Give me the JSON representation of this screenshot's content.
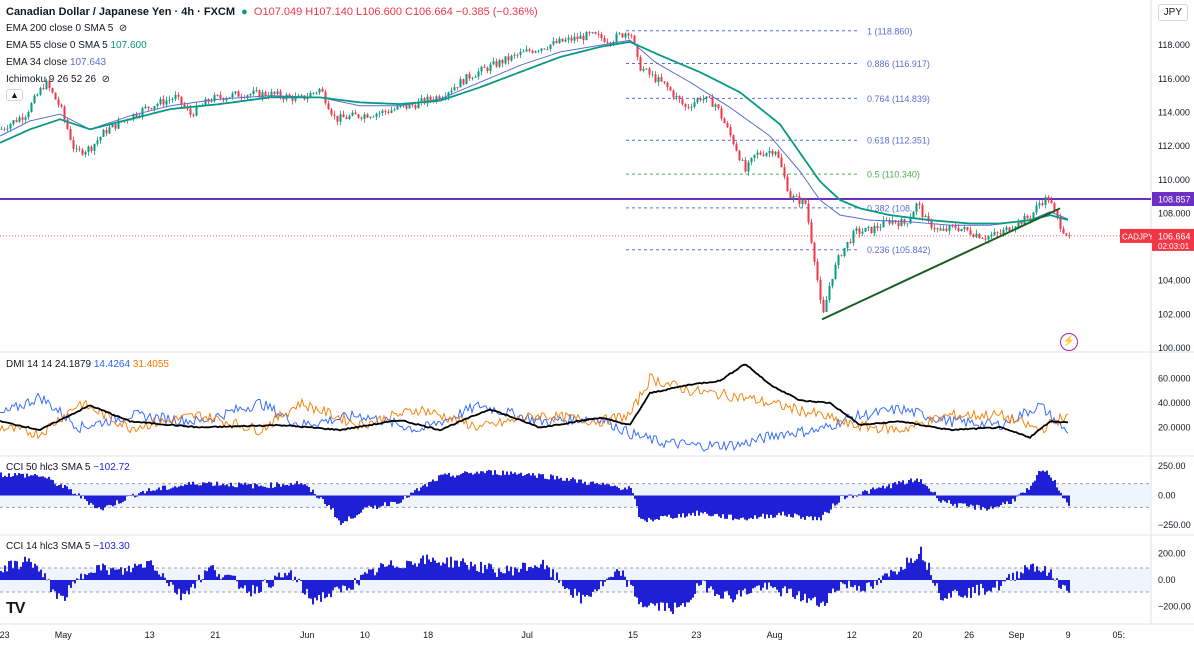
{
  "header": {
    "symbol": "Canadian Dollar / Japanese Yen · 4h · FXCM",
    "ohlc": "O107.049 H107.140 L106.600 C106.664 −0.385 (−0.36%)",
    "currency": "JPY"
  },
  "indicators": {
    "ema200": "EMA 200 close 0 SMA 5",
    "ema55": "EMA 55 close 0 SMA 5",
    "ema55_val": "107.600",
    "ema34": "EMA 34 close",
    "ema34_val": "107.643",
    "ichimoku": "Ichimoku 9 26 52 26",
    "dmi": "DMI 14 14",
    "dmi_adx": "24.1879",
    "dmi_plus": "14.4264",
    "dmi_minus": "31.4055",
    "cci50": "CCI 50 hlc3 SMA 5",
    "cci50_val": "−102.72",
    "cci14": "CCI 14 hlc3 SMA 5",
    "cci14_val": "−103.30"
  },
  "colors": {
    "up": "#089981",
    "down": "#f23645",
    "ema55": "#089981",
    "ema34": "#5b6fd4",
    "resistance": "#6b2fc4",
    "trend": "#1b5e20",
    "fib": "#5b6fd4",
    "fib_mid": "#4caf50",
    "adx": "#000000",
    "plus": "#2962ff",
    "minus": "#f57c00",
    "cci": "#1f1fd6"
  },
  "price_axis": [
    "118.000",
    "116.000",
    "114.000",
    "112.000",
    "110.000",
    "108.000",
    "104.000",
    "102.000",
    "100.000"
  ],
  "price_labels": {
    "resistance": "108.857",
    "current_symbol": "CADJPY",
    "current": "106.664",
    "countdown": "02:03:01"
  },
  "fib_levels": [
    {
      "label": "1 (118.860)",
      "value": 118.86
    },
    {
      "label": "0.886 (116.917)",
      "value": 116.917
    },
    {
      "label": "0.764 (114.839)",
      "value": 114.839
    },
    {
      "label": "0.618 (112.351)",
      "value": 112.351
    },
    {
      "label": "0.5 (110.340)",
      "value": 110.34
    },
    {
      "label": "0.382 (108.",
      "value": 108.33
    },
    {
      "label": "0.236 (105.842)",
      "value": 105.842
    }
  ],
  "dmi_axis": [
    "60.0000",
    "40.0000",
    "20.0000"
  ],
  "cci50_axis": [
    "250.00",
    "0.00",
    "−250.00"
  ],
  "cci14_axis": [
    "200.00",
    "0.00",
    "−200.00"
  ],
  "time_axis": [
    {
      "label": "23",
      "pos": 0.004
    },
    {
      "label": "May",
      "pos": 0.055
    },
    {
      "label": "13",
      "pos": 0.13
    },
    {
      "label": "21",
      "pos": 0.187
    },
    {
      "label": "Jun",
      "pos": 0.267
    },
    {
      "label": "10",
      "pos": 0.317
    },
    {
      "label": "18",
      "pos": 0.372
    },
    {
      "label": "Jul",
      "pos": 0.458
    },
    {
      "label": "15",
      "pos": 0.55
    },
    {
      "label": "23",
      "pos": 0.605
    },
    {
      "label": "Aug",
      "pos": 0.673
    },
    {
      "label": "12",
      "pos": 0.74
    },
    {
      "label": "20",
      "pos": 0.797
    },
    {
      "label": "26",
      "pos": 0.842
    },
    {
      "label": "Sep",
      "pos": 0.883
    },
    {
      "label": "9",
      "pos": 0.928
    },
    {
      "label": "05:",
      "pos": 0.972
    }
  ],
  "logo": "TV",
  "chart_data": {
    "type": "line",
    "title": "Canadian Dollar / Japanese Yen · 4h · FXCM",
    "ylim": [
      100,
      119.5
    ],
    "price_keypoints": [
      [
        0,
        113.0
      ],
      [
        25,
        113.9
      ],
      [
        45,
        115.8
      ],
      [
        60,
        114.3
      ],
      [
        75,
        111.6
      ],
      [
        90,
        111.9
      ],
      [
        105,
        112.9
      ],
      [
        125,
        113.6
      ],
      [
        150,
        114.4
      ],
      [
        175,
        114.9
      ],
      [
        190,
        113.9
      ],
      [
        210,
        114.8
      ],
      [
        240,
        115.1
      ],
      [
        270,
        115.1
      ],
      [
        300,
        114.8
      ],
      [
        320,
        115.4
      ],
      [
        335,
        113.6
      ],
      [
        355,
        113.8
      ],
      [
        380,
        114.0
      ],
      [
        410,
        114.4
      ],
      [
        440,
        115.0
      ],
      [
        470,
        116.2
      ],
      [
        500,
        117.0
      ],
      [
        530,
        117.7
      ],
      [
        560,
        118.2
      ],
      [
        590,
        118.6
      ],
      [
        610,
        118.3
      ],
      [
        630,
        118.9
      ],
      [
        638,
        116.8
      ],
      [
        648,
        116.3
      ],
      [
        665,
        115.6
      ],
      [
        685,
        114.3
      ],
      [
        700,
        114.9
      ],
      [
        715,
        114.5
      ],
      [
        735,
        112.0
      ],
      [
        745,
        110.5
      ],
      [
        755,
        111.5
      ],
      [
        775,
        111.8
      ],
      [
        790,
        109.0
      ],
      [
        805,
        108.6
      ],
      [
        815,
        105.0
      ],
      [
        822,
        101.7
      ],
      [
        830,
        104.0
      ],
      [
        840,
        105.6
      ],
      [
        855,
        106.9
      ],
      [
        870,
        107.0
      ],
      [
        890,
        107.6
      ],
      [
        905,
        107.4
      ],
      [
        917,
        108.6
      ],
      [
        925,
        107.6
      ],
      [
        940,
        106.9
      ],
      [
        955,
        107.2
      ],
      [
        970,
        106.9
      ],
      [
        985,
        106.6
      ],
      [
        1000,
        106.8
      ],
      [
        1015,
        107.4
      ],
      [
        1030,
        107.8
      ],
      [
        1040,
        108.7
      ],
      [
        1048,
        108.9
      ],
      [
        1055,
        107.9
      ],
      [
        1062,
        107.1
      ],
      [
        1069,
        106.66
      ]
    ],
    "ema55_keypoints": [
      [
        0,
        112.2
      ],
      [
        30,
        113.0
      ],
      [
        60,
        113.6
      ],
      [
        90,
        113.0
      ],
      [
        130,
        113.6
      ],
      [
        170,
        114.2
      ],
      [
        220,
        114.5
      ],
      [
        270,
        114.9
      ],
      [
        320,
        114.9
      ],
      [
        360,
        114.6
      ],
      [
        400,
        114.5
      ],
      [
        440,
        114.7
      ],
      [
        480,
        115.5
      ],
      [
        520,
        116.4
      ],
      [
        560,
        117.3
      ],
      [
        600,
        117.9
      ],
      [
        630,
        118.2
      ],
      [
        660,
        117.4
      ],
      [
        700,
        116.4
      ],
      [
        740,
        115.2
      ],
      [
        780,
        113.3
      ],
      [
        800,
        111.6
      ],
      [
        820,
        109.9
      ],
      [
        840,
        108.8
      ],
      [
        860,
        108.3
      ],
      [
        890,
        107.9
      ],
      [
        930,
        107.6
      ],
      [
        970,
        107.4
      ],
      [
        1000,
        107.4
      ],
      [
        1030,
        107.6
      ],
      [
        1050,
        107.9
      ],
      [
        1069,
        107.6
      ]
    ],
    "ema34_keypoints": [
      [
        0,
        112.6
      ],
      [
        30,
        113.5
      ],
      [
        60,
        113.9
      ],
      [
        90,
        113.0
      ],
      [
        130,
        113.8
      ],
      [
        170,
        114.4
      ],
      [
        220,
        114.8
      ],
      [
        270,
        115.0
      ],
      [
        320,
        114.9
      ],
      [
        360,
        114.4
      ],
      [
        400,
        114.4
      ],
      [
        440,
        114.8
      ],
      [
        480,
        115.8
      ],
      [
        520,
        116.8
      ],
      [
        560,
        117.6
      ],
      [
        600,
        118.0
      ],
      [
        630,
        118.3
      ],
      [
        655,
        117.0
      ],
      [
        690,
        115.8
      ],
      [
        730,
        114.3
      ],
      [
        770,
        112.6
      ],
      [
        800,
        110.5
      ],
      [
        820,
        108.8
      ],
      [
        840,
        107.9
      ],
      [
        870,
        107.6
      ],
      [
        910,
        107.5
      ],
      [
        950,
        107.3
      ],
      [
        990,
        107.3
      ],
      [
        1030,
        107.6
      ],
      [
        1050,
        108.1
      ],
      [
        1069,
        107.64
      ]
    ],
    "resistance": 108.857,
    "current": 106.664,
    "trendline": [
      [
        822,
        101.7
      ],
      [
        1060,
        108.3
      ]
    ],
    "dmi_adx_keypoints": [
      [
        0,
        25
      ],
      [
        40,
        18
      ],
      [
        90,
        38
      ],
      [
        130,
        25
      ],
      [
        200,
        20
      ],
      [
        280,
        22
      ],
      [
        340,
        18
      ],
      [
        400,
        26
      ],
      [
        440,
        18
      ],
      [
        490,
        35
      ],
      [
        540,
        20
      ],
      [
        600,
        28
      ],
      [
        630,
        22
      ],
      [
        650,
        48
      ],
      [
        690,
        55
      ],
      [
        720,
        58
      ],
      [
        745,
        72
      ],
      [
        770,
        55
      ],
      [
        800,
        42
      ],
      [
        830,
        40
      ],
      [
        860,
        22
      ],
      [
        900,
        25
      ],
      [
        950,
        18
      ],
      [
        1000,
        20
      ],
      [
        1030,
        12
      ],
      [
        1050,
        25
      ],
      [
        1069,
        24.19
      ]
    ],
    "dmi_plus_keypoints": [
      [
        0,
        30
      ],
      [
        40,
        45
      ],
      [
        80,
        20
      ],
      [
        130,
        30
      ],
      [
        200,
        25
      ],
      [
        260,
        40
      ],
      [
        300,
        22
      ],
      [
        360,
        30
      ],
      [
        420,
        18
      ],
      [
        480,
        38
      ],
      [
        540,
        25
      ],
      [
        600,
        28
      ],
      [
        630,
        15
      ],
      [
        660,
        8
      ],
      [
        700,
        5
      ],
      [
        740,
        6
      ],
      [
        780,
        15
      ],
      [
        820,
        18
      ],
      [
        850,
        28
      ],
      [
        900,
        35
      ],
      [
        950,
        25
      ],
      [
        1000,
        22
      ],
      [
        1040,
        38
      ],
      [
        1069,
        14.43
      ]
    ],
    "dmi_minus_keypoints": [
      [
        0,
        20
      ],
      [
        40,
        15
      ],
      [
        80,
        40
      ],
      [
        130,
        20
      ],
      [
        200,
        30
      ],
      [
        260,
        18
      ],
      [
        300,
        40
      ],
      [
        360,
        22
      ],
      [
        420,
        35
      ],
      [
        480,
        20
      ],
      [
        540,
        30
      ],
      [
        600,
        25
      ],
      [
        630,
        30
      ],
      [
        650,
        60
      ],
      [
        690,
        50
      ],
      [
        740,
        45
      ],
      [
        780,
        38
      ],
      [
        820,
        30
      ],
      [
        850,
        22
      ],
      [
        900,
        18
      ],
      [
        950,
        30
      ],
      [
        1000,
        30
      ],
      [
        1040,
        18
      ],
      [
        1069,
        31.41
      ]
    ],
    "cci50_keypoints": [
      [
        0,
        180
      ],
      [
        40,
        170
      ],
      [
        70,
        40
      ],
      [
        100,
        -120
      ],
      [
        140,
        30
      ],
      [
        200,
        110
      ],
      [
        260,
        80
      ],
      [
        300,
        110
      ],
      [
        330,
        -100
      ],
      [
        340,
        -250
      ],
      [
        360,
        -130
      ],
      [
        400,
        -40
      ],
      [
        440,
        160
      ],
      [
        480,
        200
      ],
      [
        520,
        190
      ],
      [
        560,
        150
      ],
      [
        600,
        90
      ],
      [
        630,
        60
      ],
      [
        640,
        -220
      ],
      [
        660,
        -190
      ],
      [
        700,
        -150
      ],
      [
        740,
        -200
      ],
      [
        780,
        -160
      ],
      [
        820,
        -200
      ],
      [
        840,
        -20
      ],
      [
        870,
        40
      ],
      [
        900,
        110
      ],
      [
        920,
        130
      ],
      [
        940,
        -40
      ],
      [
        960,
        -90
      ],
      [
        990,
        -110
      ],
      [
        1010,
        -50
      ],
      [
        1030,
        60
      ],
      [
        1040,
        220
      ],
      [
        1050,
        170
      ],
      [
        1069,
        -102.72
      ]
    ],
    "cci14_keypoints": [
      [
        0,
        80
      ],
      [
        30,
        150
      ],
      [
        60,
        -150
      ],
      [
        90,
        100
      ],
      [
        120,
        60
      ],
      [
        150,
        140
      ],
      [
        180,
        -120
      ],
      [
        210,
        90
      ],
      [
        250,
        -80
      ],
      [
        290,
        50
      ],
      [
        310,
        -150
      ],
      [
        340,
        -80
      ],
      [
        380,
        90
      ],
      [
        420,
        150
      ],
      [
        460,
        130
      ],
      [
        500,
        60
      ],
      [
        540,
        120
      ],
      [
        580,
        -150
      ],
      [
        620,
        60
      ],
      [
        640,
        -180
      ],
      [
        680,
        -220
      ],
      [
        700,
        -30
      ],
      [
        730,
        -130
      ],
      [
        760,
        -50
      ],
      [
        790,
        -100
      ],
      [
        820,
        -180
      ],
      [
        840,
        -30
      ],
      [
        870,
        -60
      ],
      [
        900,
        100
      ],
      [
        920,
        220
      ],
      [
        940,
        -110
      ],
      [
        970,
        -90
      ],
      [
        1000,
        -40
      ],
      [
        1030,
        120
      ],
      [
        1050,
        40
      ],
      [
        1069,
        -103.3
      ]
    ]
  }
}
